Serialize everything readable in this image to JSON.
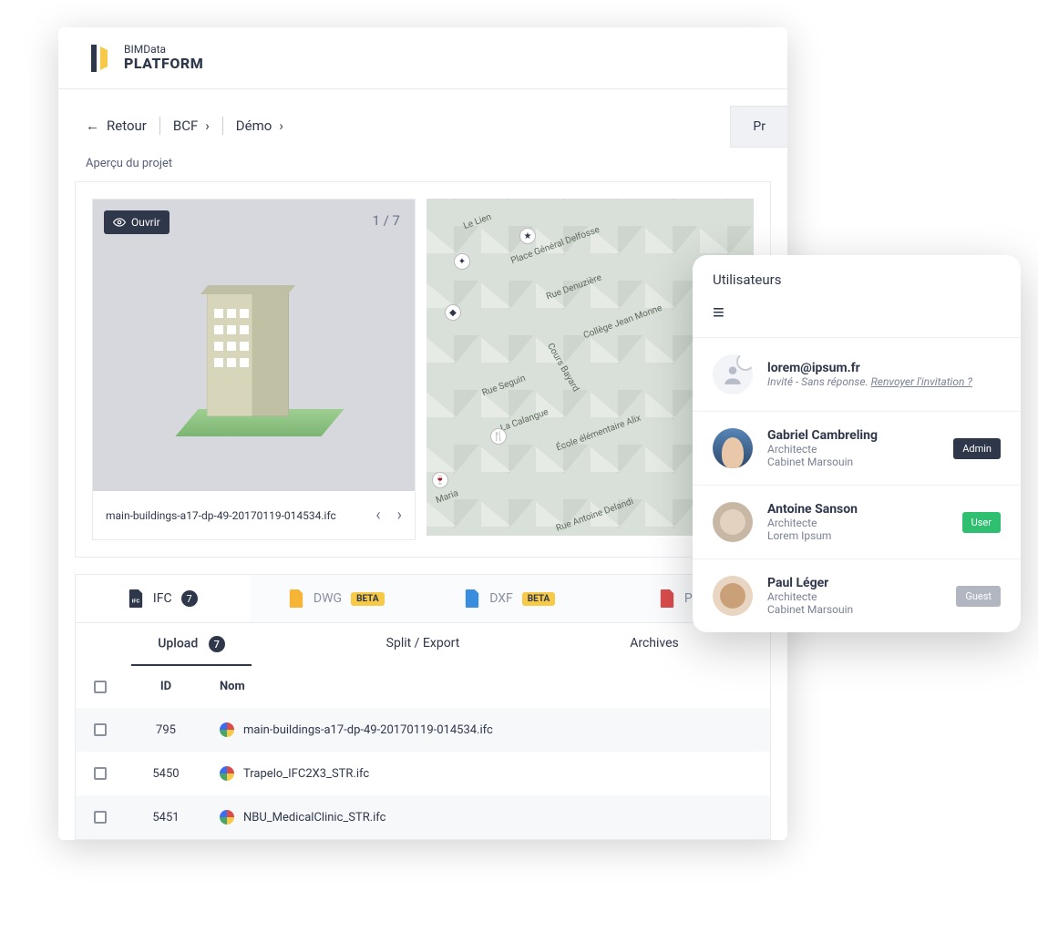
{
  "header": {
    "brand_small": "BIMData",
    "brand_big": "PLATFORM"
  },
  "breadcrumb": {
    "back": "Retour",
    "items": [
      "BCF",
      "Démo"
    ],
    "right_tab": "Pr"
  },
  "preview": {
    "title": "Aperçu du projet",
    "open_label": "Ouvrir",
    "counter": "1 / 7",
    "filename": "main-buildings-a17-dp-49-20170119-014534.ifc"
  },
  "map": {
    "labels": [
      "Le Lien",
      "Place Général Delfosse",
      "Collège Jean Monne",
      "Rue Seguin",
      "La Calangue",
      "École élémentaire Alix",
      "Maria",
      "Rue Antoine Delandi",
      "Cours Bayard",
      "Rue Denuzière"
    ]
  },
  "tabs": {
    "ifc": {
      "label": "IFC",
      "count": "7"
    },
    "dwg": {
      "label": "DWG",
      "badge": "BETA"
    },
    "dxf": {
      "label": "DXF",
      "badge": "BETA"
    },
    "pdf": {
      "label": "PDF"
    }
  },
  "subtabs": {
    "upload": {
      "label": "Upload",
      "count": "7"
    },
    "split": {
      "label": "Split / Export"
    },
    "archives": {
      "label": "Archives"
    }
  },
  "table": {
    "headers": {
      "id": "ID",
      "name": "Nom"
    },
    "rows": [
      {
        "id": "795",
        "name": "main-buildings-a17-dp-49-20170119-014534.ifc"
      },
      {
        "id": "5450",
        "name": "Trapelo_IFC2X3_STR.ifc"
      },
      {
        "id": "5451",
        "name": "NBU_MedicalClinic_STR.ifc"
      }
    ]
  },
  "users": {
    "title": "Utilisateurs",
    "pending": {
      "email": "lorem@ipsum.fr",
      "status": "Invité - Sans réponse.",
      "resend": "Renvoyer l'invitation ?"
    },
    "list": [
      {
        "name": "Gabriel Cambreling",
        "role_label": "Admin",
        "role_class": "admin",
        "job": "Architecte",
        "org": "Cabinet Marsouin"
      },
      {
        "name": "Antoine Sanson",
        "role_label": "User",
        "role_class": "user",
        "job": "Architecte",
        "org": "Lorem Ipsum"
      },
      {
        "name": "Paul Léger",
        "role_label": "Guest",
        "role_class": "guest",
        "job": "Architecte",
        "org": "Cabinet Marsouin"
      }
    ]
  }
}
